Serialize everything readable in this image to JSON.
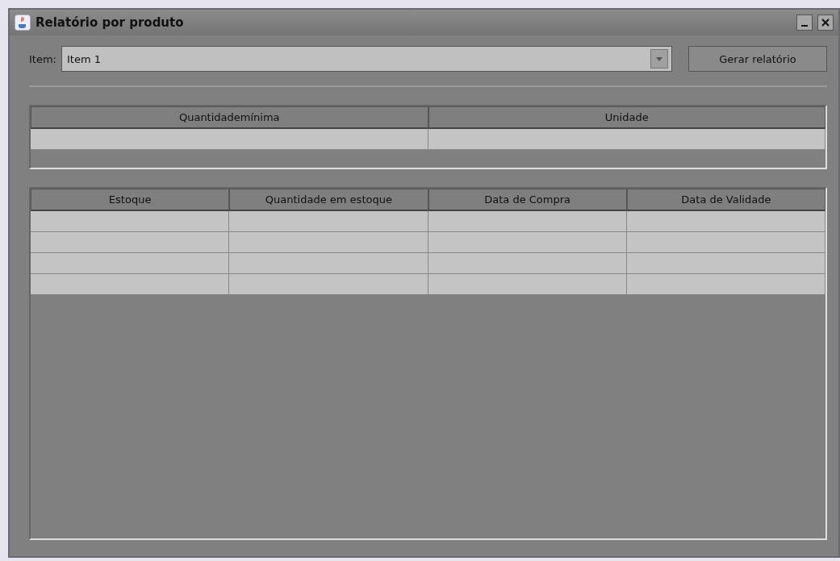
{
  "window": {
    "title": "Relatório por produto"
  },
  "item_field": {
    "label": "Item:",
    "value": "Item 1"
  },
  "generate_button": {
    "label": "Gerar relatório"
  },
  "summary_table": {
    "columns": [
      "Quantidademínima",
      "Unidade"
    ],
    "rows": [
      {
        "selected": false
      }
    ]
  },
  "stock_table": {
    "columns": [
      "Estoque",
      "Quantidade em estoque",
      "Data de Compra",
      "Data de Validade"
    ],
    "rows": [
      {
        "selected": false
      },
      {
        "selected": false
      },
      {
        "selected": false
      },
      {
        "selected": false
      }
    ]
  }
}
